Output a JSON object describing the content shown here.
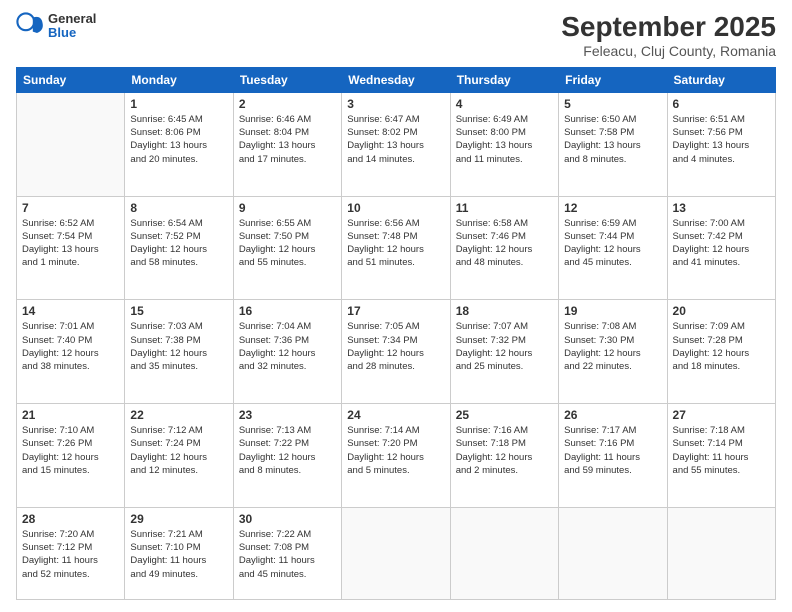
{
  "header": {
    "logo": {
      "general": "General",
      "blue": "Blue"
    },
    "title": "September 2025",
    "subtitle": "Feleacu, Cluj County, Romania"
  },
  "weekdays": [
    "Sunday",
    "Monday",
    "Tuesday",
    "Wednesday",
    "Thursday",
    "Friday",
    "Saturday"
  ],
  "weeks": [
    [
      {
        "day": "",
        "info": ""
      },
      {
        "day": "1",
        "info": "Sunrise: 6:45 AM\nSunset: 8:06 PM\nDaylight: 13 hours\nand 20 minutes."
      },
      {
        "day": "2",
        "info": "Sunrise: 6:46 AM\nSunset: 8:04 PM\nDaylight: 13 hours\nand 17 minutes."
      },
      {
        "day": "3",
        "info": "Sunrise: 6:47 AM\nSunset: 8:02 PM\nDaylight: 13 hours\nand 14 minutes."
      },
      {
        "day": "4",
        "info": "Sunrise: 6:49 AM\nSunset: 8:00 PM\nDaylight: 13 hours\nand 11 minutes."
      },
      {
        "day": "5",
        "info": "Sunrise: 6:50 AM\nSunset: 7:58 PM\nDaylight: 13 hours\nand 8 minutes."
      },
      {
        "day": "6",
        "info": "Sunrise: 6:51 AM\nSunset: 7:56 PM\nDaylight: 13 hours\nand 4 minutes."
      }
    ],
    [
      {
        "day": "7",
        "info": "Sunrise: 6:52 AM\nSunset: 7:54 PM\nDaylight: 13 hours\nand 1 minute."
      },
      {
        "day": "8",
        "info": "Sunrise: 6:54 AM\nSunset: 7:52 PM\nDaylight: 12 hours\nand 58 minutes."
      },
      {
        "day": "9",
        "info": "Sunrise: 6:55 AM\nSunset: 7:50 PM\nDaylight: 12 hours\nand 55 minutes."
      },
      {
        "day": "10",
        "info": "Sunrise: 6:56 AM\nSunset: 7:48 PM\nDaylight: 12 hours\nand 51 minutes."
      },
      {
        "day": "11",
        "info": "Sunrise: 6:58 AM\nSunset: 7:46 PM\nDaylight: 12 hours\nand 48 minutes."
      },
      {
        "day": "12",
        "info": "Sunrise: 6:59 AM\nSunset: 7:44 PM\nDaylight: 12 hours\nand 45 minutes."
      },
      {
        "day": "13",
        "info": "Sunrise: 7:00 AM\nSunset: 7:42 PM\nDaylight: 12 hours\nand 41 minutes."
      }
    ],
    [
      {
        "day": "14",
        "info": "Sunrise: 7:01 AM\nSunset: 7:40 PM\nDaylight: 12 hours\nand 38 minutes."
      },
      {
        "day": "15",
        "info": "Sunrise: 7:03 AM\nSunset: 7:38 PM\nDaylight: 12 hours\nand 35 minutes."
      },
      {
        "day": "16",
        "info": "Sunrise: 7:04 AM\nSunset: 7:36 PM\nDaylight: 12 hours\nand 32 minutes."
      },
      {
        "day": "17",
        "info": "Sunrise: 7:05 AM\nSunset: 7:34 PM\nDaylight: 12 hours\nand 28 minutes."
      },
      {
        "day": "18",
        "info": "Sunrise: 7:07 AM\nSunset: 7:32 PM\nDaylight: 12 hours\nand 25 minutes."
      },
      {
        "day": "19",
        "info": "Sunrise: 7:08 AM\nSunset: 7:30 PM\nDaylight: 12 hours\nand 22 minutes."
      },
      {
        "day": "20",
        "info": "Sunrise: 7:09 AM\nSunset: 7:28 PM\nDaylight: 12 hours\nand 18 minutes."
      }
    ],
    [
      {
        "day": "21",
        "info": "Sunrise: 7:10 AM\nSunset: 7:26 PM\nDaylight: 12 hours\nand 15 minutes."
      },
      {
        "day": "22",
        "info": "Sunrise: 7:12 AM\nSunset: 7:24 PM\nDaylight: 12 hours\nand 12 minutes."
      },
      {
        "day": "23",
        "info": "Sunrise: 7:13 AM\nSunset: 7:22 PM\nDaylight: 12 hours\nand 8 minutes."
      },
      {
        "day": "24",
        "info": "Sunrise: 7:14 AM\nSunset: 7:20 PM\nDaylight: 12 hours\nand 5 minutes."
      },
      {
        "day": "25",
        "info": "Sunrise: 7:16 AM\nSunset: 7:18 PM\nDaylight: 12 hours\nand 2 minutes."
      },
      {
        "day": "26",
        "info": "Sunrise: 7:17 AM\nSunset: 7:16 PM\nDaylight: 11 hours\nand 59 minutes."
      },
      {
        "day": "27",
        "info": "Sunrise: 7:18 AM\nSunset: 7:14 PM\nDaylight: 11 hours\nand 55 minutes."
      }
    ],
    [
      {
        "day": "28",
        "info": "Sunrise: 7:20 AM\nSunset: 7:12 PM\nDaylight: 11 hours\nand 52 minutes."
      },
      {
        "day": "29",
        "info": "Sunrise: 7:21 AM\nSunset: 7:10 PM\nDaylight: 11 hours\nand 49 minutes."
      },
      {
        "day": "30",
        "info": "Sunrise: 7:22 AM\nSunset: 7:08 PM\nDaylight: 11 hours\nand 45 minutes."
      },
      {
        "day": "",
        "info": ""
      },
      {
        "day": "",
        "info": ""
      },
      {
        "day": "",
        "info": ""
      },
      {
        "day": "",
        "info": ""
      }
    ]
  ]
}
